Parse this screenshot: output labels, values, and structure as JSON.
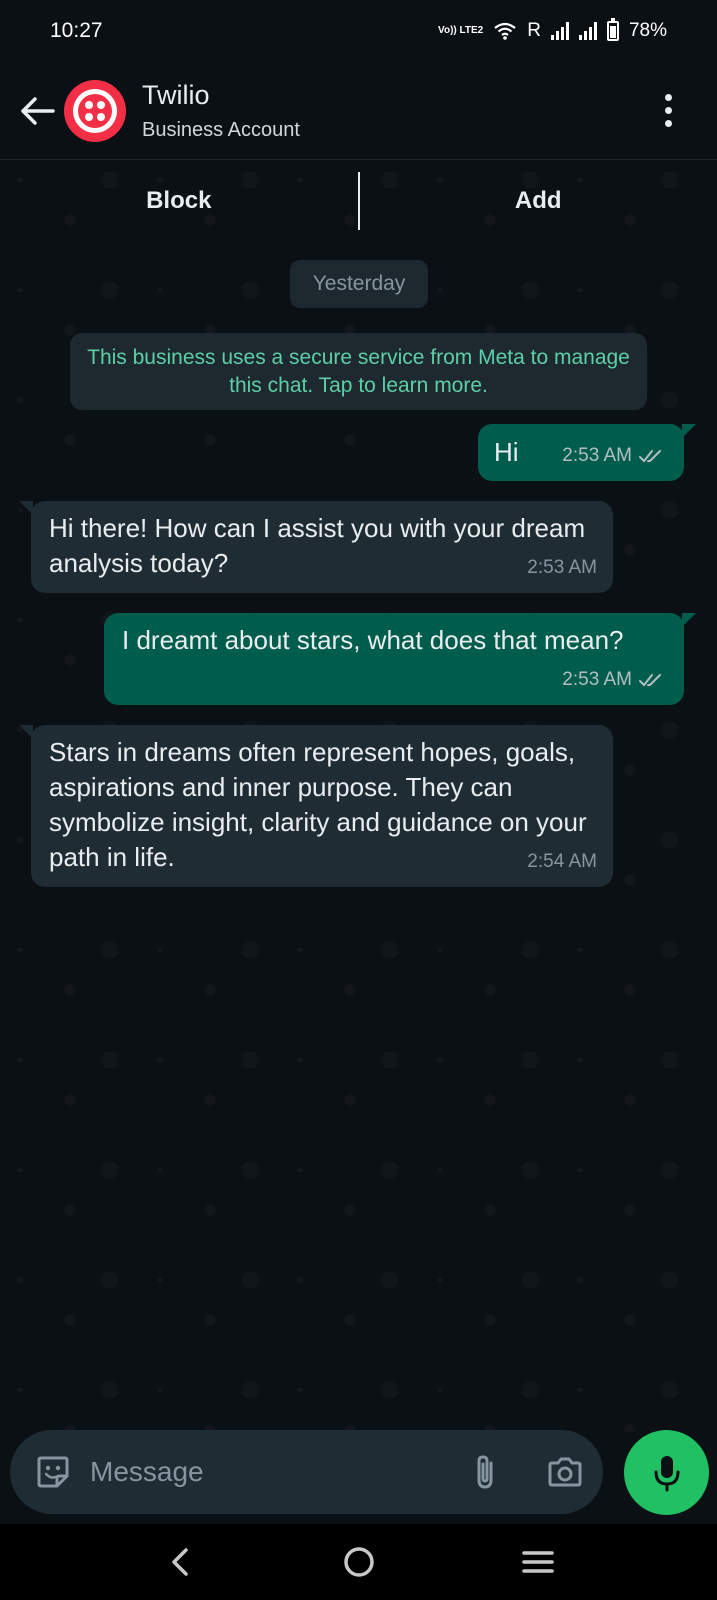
{
  "status_bar": {
    "time": "10:27",
    "network_label": "Vo)) LTE2",
    "roaming": "R",
    "battery": "78%",
    "battery_level": 0.78
  },
  "header": {
    "contact_name": "Twilio",
    "contact_subtitle": "Business Account",
    "avatar_color": "#f22f46"
  },
  "actions": {
    "block_label": "Block",
    "add_label": "Add"
  },
  "chat": {
    "date_chip": "Yesterday",
    "system_notice": "This business uses a secure service from Meta to manage this chat. Tap to learn more.",
    "messages": [
      {
        "direction": "out",
        "text": "Hi",
        "time": "2:53 AM",
        "status": "read"
      },
      {
        "direction": "in",
        "text": "Hi there! How can I assist you with your dream analysis today?",
        "time": "2:53 AM"
      },
      {
        "direction": "out",
        "text": "I dreamt about stars, what does that mean?",
        "time": "2:53 AM",
        "status": "read"
      },
      {
        "direction": "in",
        "text": "Stars in dreams often represent hopes, goals, aspirations and inner purpose. They can symbolize insight, clarity and guidance on your path in life.",
        "time": "2:54 AM"
      }
    ]
  },
  "composer": {
    "placeholder": "Message",
    "icons": [
      "sticker-icon",
      "attach-icon",
      "camera-icon",
      "mic-icon"
    ],
    "mic_color": "#21c063"
  },
  "colors": {
    "outgoing_bubble": "#005c4b",
    "incoming_bubble": "#1f2c33",
    "system_text": "#5dcfa6"
  }
}
